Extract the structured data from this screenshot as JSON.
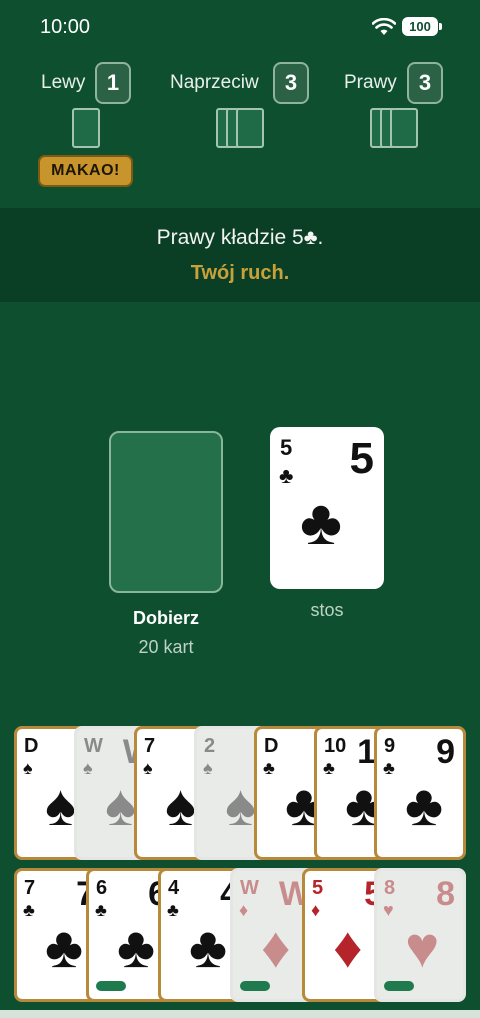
{
  "status": {
    "time": "10:00",
    "battery": "100",
    "wifi_icon": "wifi-icon"
  },
  "opponents": [
    {
      "name": "Lewy",
      "count": "1"
    },
    {
      "name": "Naprzeciw",
      "count": "3"
    },
    {
      "name": "Prawy",
      "count": "3"
    }
  ],
  "makao_label": "MAKAO!",
  "message": "Prawy kładzie 5♣.",
  "turn": "Twój ruch.",
  "deck": {
    "label": "Dobierz",
    "count": "20 kart"
  },
  "pile": {
    "label": "stos",
    "rank": "5",
    "suit": "♣"
  },
  "hand_row1": [
    {
      "rank": "D",
      "suit": "♠"
    },
    {
      "rank": "W",
      "suit": "♠"
    },
    {
      "rank": "7",
      "suit": "♠"
    },
    {
      "rank": "2",
      "suit": "♠"
    },
    {
      "rank": "D",
      "suit": "♣"
    },
    {
      "rank": "10",
      "suit": "♣"
    },
    {
      "rank": "9",
      "suit": "♣"
    }
  ],
  "hand_row2": [
    {
      "rank": "7",
      "suit": "♣"
    },
    {
      "rank": "6",
      "suit": "♣"
    },
    {
      "rank": "4",
      "suit": "♣"
    },
    {
      "rank": "W",
      "suit": "♦"
    },
    {
      "rank": "5",
      "suit": "♦"
    },
    {
      "rank": "8",
      "suit": "♥"
    }
  ],
  "colors": {
    "felt": "#0e4f30",
    "accent": "#c9a13a",
    "makao": "#c8942c"
  }
}
